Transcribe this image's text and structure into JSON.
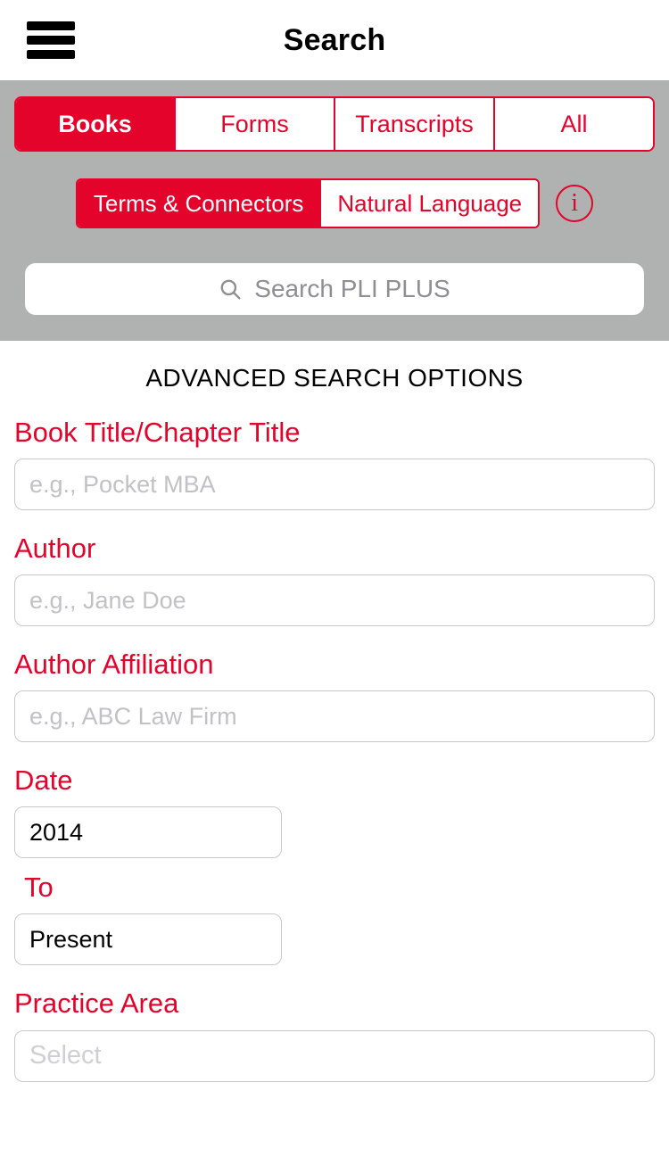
{
  "header": {
    "title": "Search",
    "menu_icon": "hamburger-menu-icon"
  },
  "search_panel": {
    "content_tabs": [
      {
        "label": "Books",
        "active": true
      },
      {
        "label": "Forms",
        "active": false
      },
      {
        "label": "Transcripts",
        "active": false
      },
      {
        "label": "All",
        "active": false
      }
    ],
    "search_modes": [
      {
        "label": "Terms & Connectors",
        "active": true
      },
      {
        "label": "Natural Language",
        "active": false
      }
    ],
    "info_icon_label": "i",
    "search_input": {
      "placeholder": "Search PLI PLUS",
      "value": "",
      "icon": "search-icon"
    }
  },
  "advanced": {
    "heading": "ADVANCED SEARCH OPTIONS",
    "fields": {
      "book_title": {
        "label": "Book Title/Chapter Title",
        "placeholder": "e.g., Pocket MBA",
        "value": ""
      },
      "author": {
        "label": "Author",
        "placeholder": "e.g., Jane Doe",
        "value": ""
      },
      "author_affiliation": {
        "label": "Author Affiliation",
        "placeholder": "e.g., ABC Law Firm",
        "value": ""
      },
      "date_from": {
        "label": "Date",
        "value": "2014"
      },
      "date_to": {
        "label": "To",
        "value": "Present"
      },
      "practice_area": {
        "label": "Practice Area",
        "placeholder": "Select",
        "value": ""
      }
    }
  },
  "colors": {
    "brand_red": "#e4032b",
    "panel_gray": "#b0b2b2",
    "placeholder_gray": "#c2c2c6",
    "border_gray": "#c8c8cc"
  }
}
